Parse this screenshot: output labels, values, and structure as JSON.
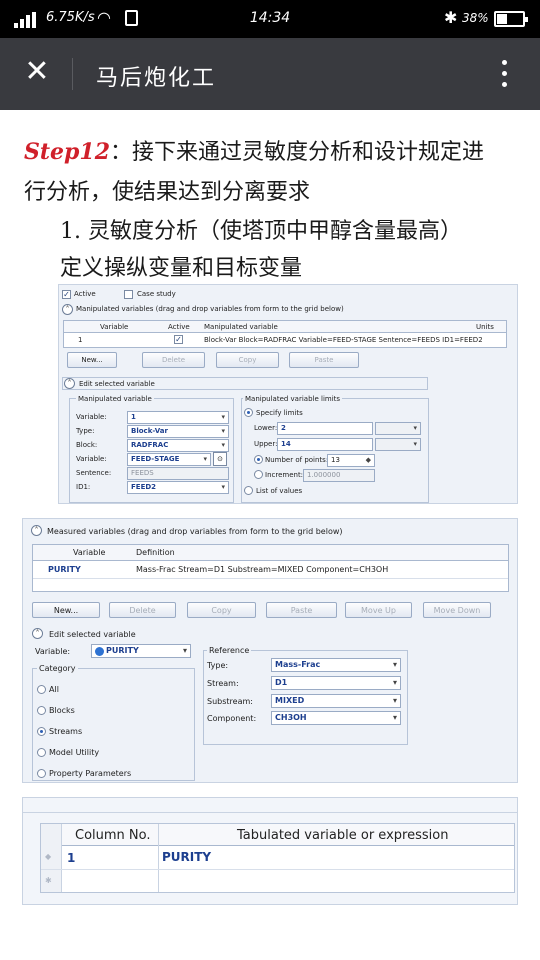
{
  "status_bar": {
    "network_speed": "6.75K/s",
    "time": "14:34",
    "battery_percent": "38%",
    "battery_level": 0.38
  },
  "title_bar": {
    "close_icon": "close-icon",
    "title": "马后炮化工",
    "more_icon": "more-vertical-icon"
  },
  "article": {
    "step_label": "Step12",
    "line1_rest": "：接下来通过灵敏度分析和设计规定进",
    "line2": "行分析，使结果达到分离要求",
    "line3": "1. 灵敏度分析（使塔顶中甲醇含量最高）",
    "line4": "定义操纵变量和目标变量"
  },
  "panel1": {
    "active_label": "Active",
    "active_checked": true,
    "case_study_label": "Case study",
    "case_study_checked": false,
    "section_title": "Manipulated variables (drag and drop variables from form to the grid below)",
    "grid_headers": [
      "Variable",
      "Active",
      "Manipulated variable",
      "Units"
    ],
    "grid_row": {
      "variable": "1",
      "active": "✓",
      "manipulated": "Block-Var Block=RADFRAC Variable=FEED-STAGE Sentence=FEEDS ID1=FEED2",
      "units": ""
    },
    "buttons": [
      "New...",
      "Delete",
      "Copy",
      "Paste"
    ],
    "edit_section_title": "Edit selected variable",
    "mv_group_title": "Manipulated variable",
    "fields": [
      {
        "label": "Variable:",
        "value": "1"
      },
      {
        "label": "Type:",
        "value": "Block-Var"
      },
      {
        "label": "Block:",
        "value": "RADFRAC"
      },
      {
        "label": "Variable:",
        "value": "FEED-STAGE"
      },
      {
        "label": "Sentence:",
        "value": "FEEDS"
      },
      {
        "label": "ID1:",
        "value": "FEED2"
      }
    ],
    "limits_group_title": "Manipulated variable limits",
    "specify_limits": "Specify limits",
    "lower_label": "Lower:",
    "lower_value": "2",
    "upper_label": "Upper:",
    "upper_value": "14",
    "num_points_label": "Number of points:",
    "num_points_value": "13",
    "increment_label": "Increment:",
    "increment_value": "1.000000",
    "list_of_values": "List of values"
  },
  "panel2": {
    "section_title": "Measured variables (drag and drop variables from form to the grid below)",
    "grid_headers": [
      "Variable",
      "Definition"
    ],
    "grid_row": {
      "variable": "PURITY",
      "definition": "Mass-Frac Stream=D1 Substream=MIXED Component=CH3OH"
    },
    "buttons": [
      "New...",
      "Delete",
      "Copy",
      "Paste",
      "Move Up",
      "Move Down"
    ],
    "edit_section_title": "Edit selected variable",
    "variable_label": "Variable:",
    "variable_value": "PURITY",
    "category_title": "Category",
    "categories": [
      "All",
      "Blocks",
      "Streams",
      "Model Utility",
      "Property Parameters"
    ],
    "selected_category": "Streams",
    "reference_title": "Reference",
    "reference_fields": [
      {
        "label": "Type:",
        "value": "Mass-Frac"
      },
      {
        "label": "Stream:",
        "value": "D1"
      },
      {
        "label": "Substream:",
        "value": "MIXED"
      },
      {
        "label": "Component:",
        "value": "CH3OH"
      }
    ]
  },
  "panel3": {
    "headers": [
      "Column No.",
      "Tabulated variable or expression"
    ],
    "row": {
      "column_no": "1",
      "expression": "PURITY"
    }
  }
}
